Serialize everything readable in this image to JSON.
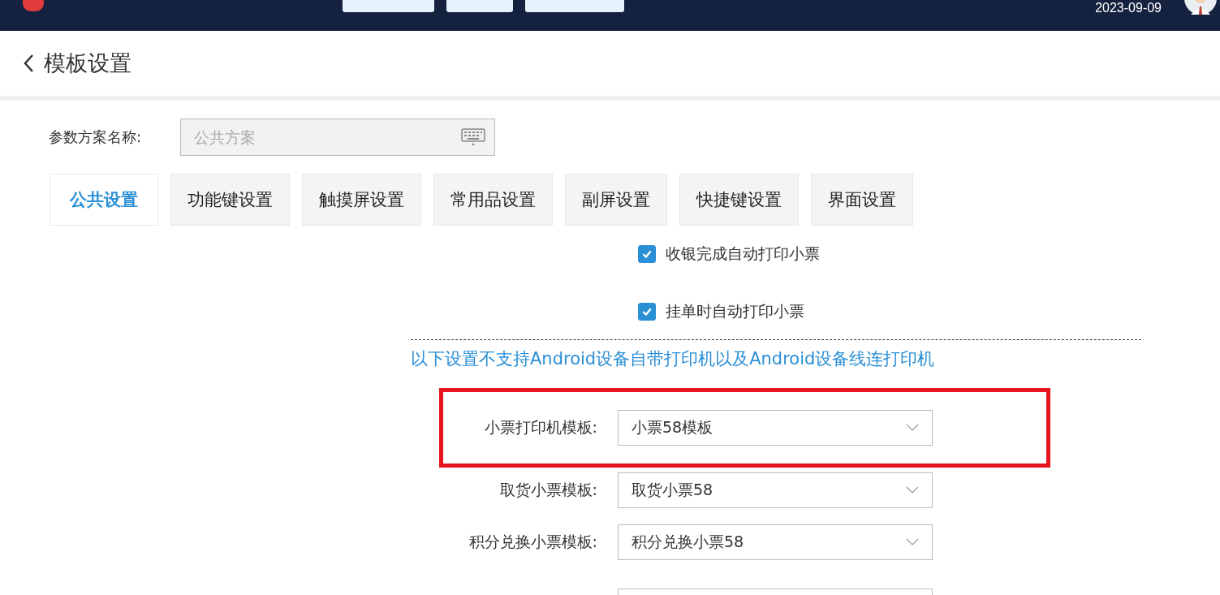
{
  "top_bar": {
    "date": "2023-09-09"
  },
  "page": {
    "title": "模板设置"
  },
  "scheme": {
    "label": "参数方案名称:",
    "placeholder": "公共方案"
  },
  "tabs": [
    {
      "label": "公共设置",
      "selected": true
    },
    {
      "label": "功能键设置",
      "selected": false
    },
    {
      "label": "触摸屏设置",
      "selected": false
    },
    {
      "label": "常用品设置",
      "selected": false
    },
    {
      "label": "副屏设置",
      "selected": false
    },
    {
      "label": "快捷键设置",
      "selected": false
    },
    {
      "label": "界面设置",
      "selected": false
    }
  ],
  "options": [
    {
      "label": "收银完成自动打印小票",
      "checked": true
    },
    {
      "label": "挂单时自动打印小票",
      "checked": true
    }
  ],
  "notice": "以下设置不支持Android设备自带打印机以及Android设备线连打印机",
  "templates": [
    {
      "label": "小票打印机模板:",
      "value": "小票58模板",
      "highlighted": true
    },
    {
      "label": "取货小票模板:",
      "value": "取货小票58",
      "highlighted": false
    },
    {
      "label": "积分兑换小票模板:",
      "value": "积分兑换小票58",
      "highlighted": false
    }
  ]
}
